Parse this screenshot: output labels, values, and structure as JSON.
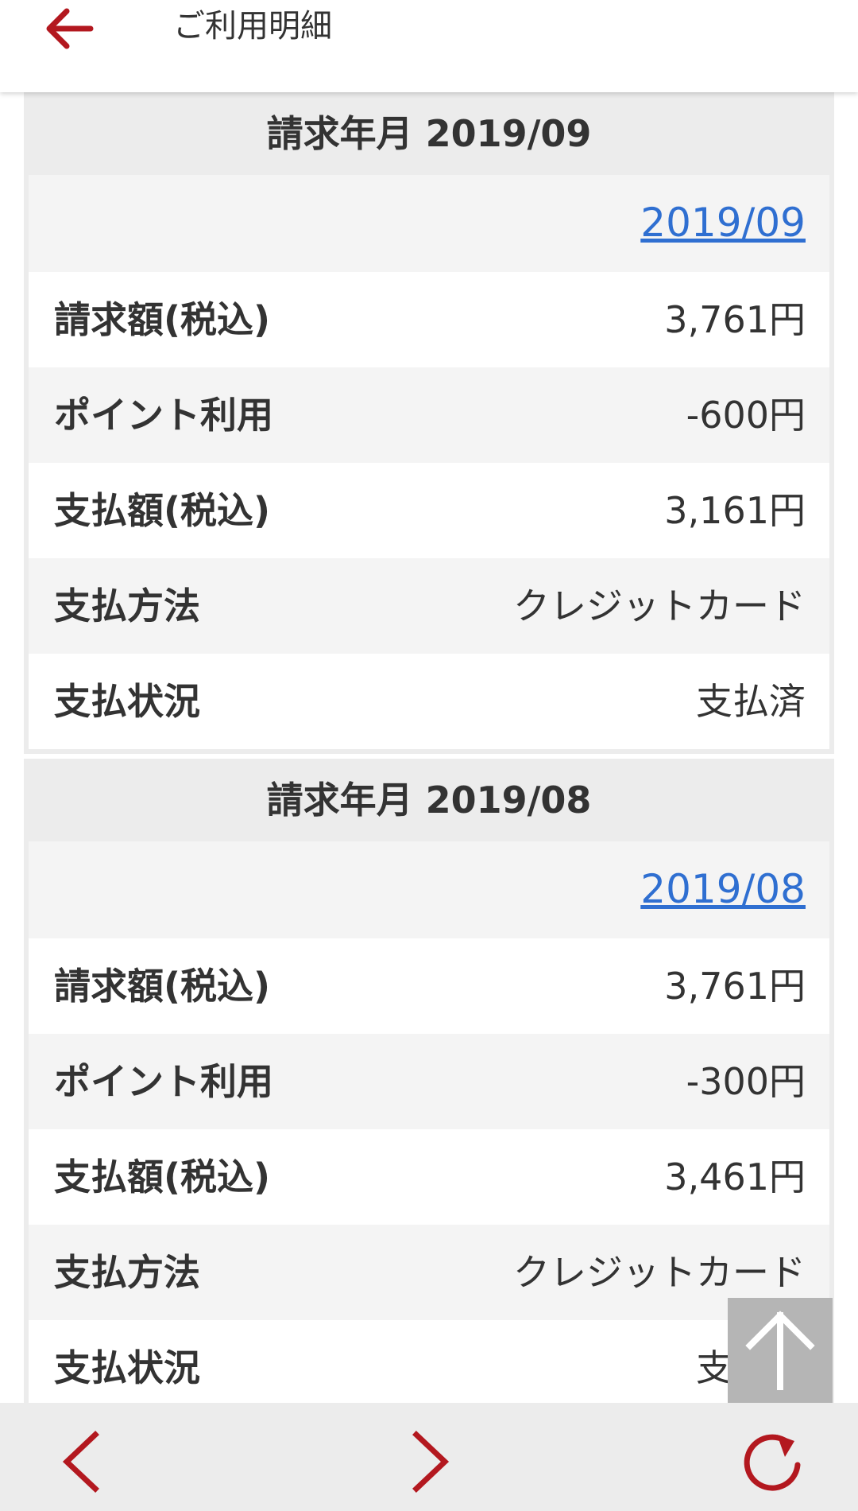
{
  "header": {
    "title": "ご利用明細",
    "back_icon": "arrow-left-icon"
  },
  "accent_color": "#b3181f",
  "link_color": "#2f6fd1",
  "statements": [
    {
      "title": "請求年月 2019/09",
      "link": "2019/09",
      "rows": [
        {
          "label": "請求額(税込)",
          "value": "3,761円"
        },
        {
          "label": "ポイント利用",
          "value": "-600円"
        },
        {
          "label": "支払額(税込)",
          "value": "3,161円"
        },
        {
          "label": "支払方法",
          "value": "クレジットカード"
        },
        {
          "label": "支払状況",
          "value": "支払済"
        }
      ]
    },
    {
      "title": "請求年月 2019/08",
      "link": "2019/08",
      "rows": [
        {
          "label": "請求額(税込)",
          "value": "3,761円"
        },
        {
          "label": "ポイント利用",
          "value": "-300円"
        },
        {
          "label": "支払額(税込)",
          "value": "3,461円"
        },
        {
          "label": "支払方法",
          "value": "クレジットカード"
        },
        {
          "label": "支払状況",
          "value": "支払済"
        }
      ]
    }
  ],
  "scroll_top_icon": "arrow-up-icon",
  "footer": {
    "prev_icon": "chevron-left-icon",
    "next_icon": "chevron-right-icon",
    "reload_icon": "reload-icon"
  }
}
